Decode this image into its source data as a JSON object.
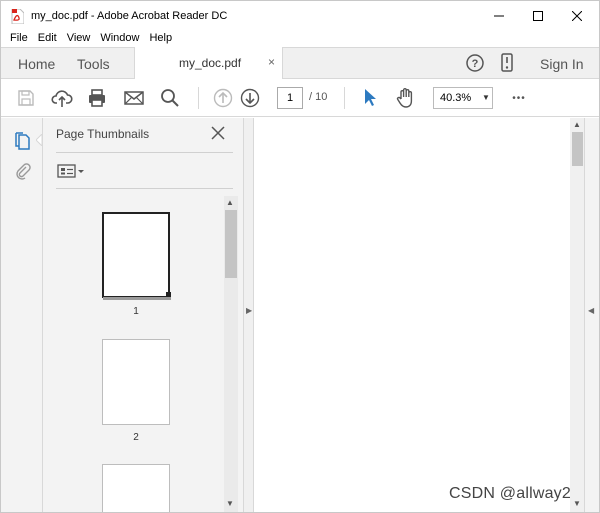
{
  "window": {
    "title": "my_doc.pdf - Adobe Acrobat Reader DC"
  },
  "menu": {
    "items": [
      "File",
      "Edit",
      "View",
      "Window",
      "Help"
    ]
  },
  "tabs": {
    "home": "Home",
    "tools": "Tools",
    "document": "my_doc.pdf",
    "close": "×",
    "sign_in": "Sign In"
  },
  "toolbar": {
    "current_page": "1",
    "page_total": "/  10",
    "zoom": "40.3%",
    "more": "•••"
  },
  "thumbnails": {
    "title": "Page Thumbnails",
    "pages": [
      {
        "label": "1",
        "selected": true
      },
      {
        "label": "2",
        "selected": false
      },
      {
        "label": "",
        "selected": false
      }
    ]
  },
  "watermark": "CSDN @allway2",
  "colors": {
    "accent": "#2d7ac0",
    "pdf_red": "#d9251c"
  }
}
